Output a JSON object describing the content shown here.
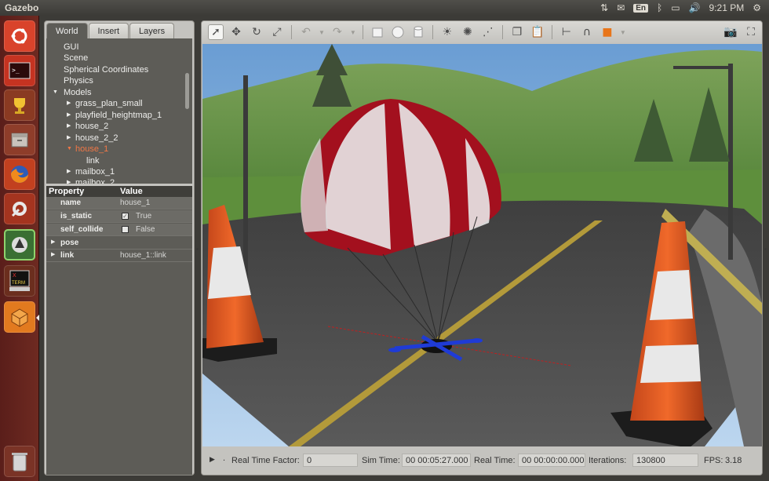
{
  "topbar": {
    "app_title": "Gazebo",
    "keyboard_layout": "En",
    "clock": "9:21 PM"
  },
  "launcher": {
    "items": [
      {
        "icon": "ubuntu-dash-icon"
      },
      {
        "icon": "terminal-icon"
      },
      {
        "icon": "trophy-icon"
      },
      {
        "icon": "file-manager-icon"
      },
      {
        "icon": "firefox-icon"
      },
      {
        "icon": "system-settings-icon"
      },
      {
        "icon": "software-updater-icon"
      },
      {
        "icon": "xterm-icon",
        "label": "XTERM"
      },
      {
        "icon": "gazebo-icon"
      },
      {
        "icon": "trash-icon"
      }
    ]
  },
  "left_panel": {
    "tabs": [
      "World",
      "Insert",
      "Layers"
    ],
    "active_tab": "World",
    "tree": {
      "top_items": [
        "GUI",
        "Scene",
        "Spherical Coordinates",
        "Physics"
      ],
      "models_label": "Models",
      "models": [
        "grass_plan_small",
        "playfield_heightmap_1",
        "house_2",
        "house_2_2",
        "house_1",
        "mailbox_1",
        "mailbox_2"
      ],
      "selected_model": "house_1",
      "selected_child": "link"
    },
    "properties": {
      "header_property": "Property",
      "header_value": "Value",
      "rows": [
        {
          "key": "name",
          "value": "house_1"
        },
        {
          "key": "is_static",
          "value": "True",
          "checked": true
        },
        {
          "key": "self_collide",
          "value": "False",
          "checked": false
        },
        {
          "key": "pose",
          "value": ""
        },
        {
          "key": "link",
          "value": "house_1::link"
        }
      ]
    }
  },
  "toolbar": {
    "tools": [
      "select-arrow-icon",
      "translate-icon",
      "rotate-icon",
      "scale-icon",
      "undo-icon",
      "redo-icon",
      "box-icon",
      "sphere-icon",
      "cylinder-icon",
      "point-light-icon",
      "spot-light-icon",
      "directional-light-icon",
      "copy-icon",
      "paste-icon",
      "align-icon",
      "snap-icon",
      "change-view-icon",
      "screenshot-icon"
    ],
    "active_tool": "select-arrow-icon"
  },
  "status": {
    "real_time_factor_label": "Real Time Factor:",
    "real_time_factor": "0",
    "sim_time_label": "Sim Time:",
    "sim_time": "00 00:05:27.000",
    "real_time_label": "Real Time:",
    "real_time": "00 00:00:00.000",
    "iterations_label": "Iterations:",
    "iterations": "130800",
    "fps_label": "FPS:",
    "fps": "3.18"
  },
  "colors": {
    "launcher_bg": "#6e2a21",
    "panel_bg": "#5d5c57",
    "selected_text": "#f07746",
    "parachute_red": "#a3101e",
    "cone_orange": "#e8531c",
    "drone_blue": "#1f3bd6"
  }
}
